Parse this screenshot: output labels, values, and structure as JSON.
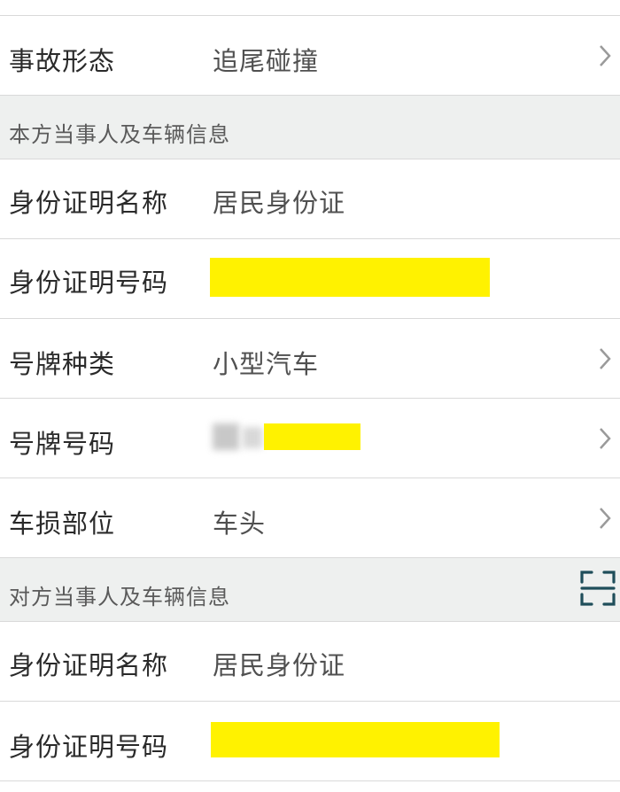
{
  "rows": {
    "accident_form": {
      "label": "事故形态",
      "value": "追尾碰撞"
    },
    "own_id_name": {
      "label": "身份证明名称",
      "value": "居民身份证"
    },
    "own_id_number": {
      "label": "身份证明号码",
      "value": ""
    },
    "plate_type": {
      "label": "号牌种类",
      "value": "小型汽车"
    },
    "plate_number": {
      "label": "号牌号码",
      "value": ""
    },
    "damage_part": {
      "label": "车损部位",
      "value": "车头"
    },
    "other_id_name": {
      "label": "身份证明名称",
      "value": "居民身份证"
    },
    "other_id_number": {
      "label": "身份证明号码",
      "value": ""
    }
  },
  "sections": {
    "own": {
      "title": "本方当事人及车辆信息"
    },
    "other": {
      "title": "对方当事人及车辆信息"
    }
  },
  "icons": {
    "chevron": "chevron-right-icon",
    "scan": "scan-icon"
  },
  "colors": {
    "section_background": "#eef0ef",
    "redaction": "#fff200",
    "scan_icon": "#1f4e5a",
    "divider": "#d9d9d9"
  }
}
